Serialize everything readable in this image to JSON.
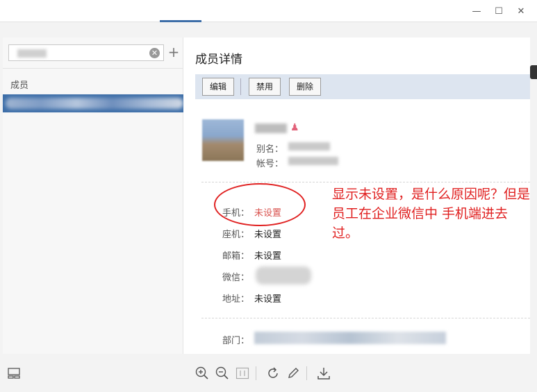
{
  "window": {
    "minimize_glyph": "—",
    "maximize_glyph": "☐",
    "close_glyph": "✕"
  },
  "sidebar": {
    "search": {
      "clear_glyph": "✕"
    },
    "add_glyph": "+",
    "group_label": "成员"
  },
  "main": {
    "title": "成员详情",
    "toolbar": {
      "edit_label": "编辑",
      "disable_label": "禁用",
      "delete_label": "删除"
    },
    "profile": {
      "person_glyph": "♟",
      "alias_label": "别名：",
      "account_label": "帐号："
    },
    "fields": {
      "mobile_label": "手机：",
      "mobile_value": "未设置",
      "landline_label": "座机：",
      "landline_value": "未设置",
      "email_label": "邮箱：",
      "email_value": "未设置",
      "wechat_label": "微信：",
      "address_label": "地址：",
      "address_value": "未设置",
      "department_label": "部门："
    }
  },
  "annotation": {
    "text": "显示未设置，是什么原因呢？但是员工在企业微信中 手机端进去过。",
    "color": "#e02020"
  },
  "bottom_bar": {
    "icons": [
      "layout-icon",
      "zoom-in-icon",
      "zoom-out-icon",
      "actual-size-icon",
      "rotate-icon",
      "edit-icon",
      "download-icon"
    ]
  },
  "colors": {
    "accent": "#3d6ea8",
    "toolbar_bg": "#dde5f0",
    "alert": "#d9534f"
  }
}
